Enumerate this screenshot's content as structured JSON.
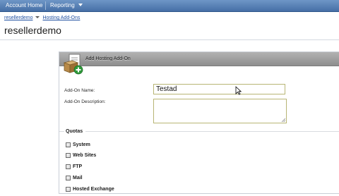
{
  "nav": {
    "home_label": "Account Home",
    "reporting_label": "Reporting"
  },
  "breadcrumb": {
    "items": [
      "resellerdemo",
      "Hosting Add-Ons"
    ]
  },
  "page": {
    "title": "resellerdemo"
  },
  "panel": {
    "header_title": "Add Hosting Add-On",
    "header_icon": "hosting-addon-package-icon"
  },
  "form": {
    "name_label": "Add-On Name:",
    "name_value": "Testad",
    "description_label": "Add-On Description:",
    "description_value": ""
  },
  "quotas": {
    "title": "Quotas",
    "items": [
      {
        "label": "System",
        "checked": false
      },
      {
        "label": "Web Sites",
        "checked": false
      },
      {
        "label": "FTP",
        "checked": false
      },
      {
        "label": "Mail",
        "checked": false
      },
      {
        "label": "Hosted Exchange",
        "checked": false
      }
    ]
  },
  "colors": {
    "nav_bar": "#5a80b4",
    "link": "#1f4fa0",
    "panel_header": "#9e9e9e",
    "input_border": "#b8b574"
  }
}
